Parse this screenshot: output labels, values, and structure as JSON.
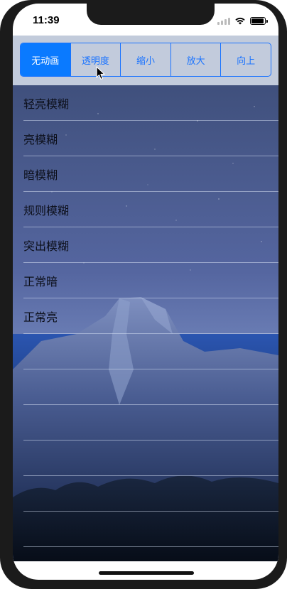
{
  "status_bar": {
    "time": "11:39"
  },
  "segment_control": {
    "selected_index": 0,
    "items": [
      "无动画",
      "透明度",
      "缩小",
      "放大",
      "向上"
    ]
  },
  "list": {
    "rows": [
      "轻亮模糊",
      "亮模糊",
      "暗模糊",
      "规则模糊",
      "突出模糊",
      "正常暗",
      "正常亮",
      "",
      "",
      "",
      "",
      "",
      ""
    ]
  },
  "colors": {
    "accent": "#0a7aff",
    "segment_bar_bg": "#c8d0e0",
    "sky_top": "#3a4a73",
    "sky_mid": "#5566a0",
    "mountain": "#6a7fb0",
    "forest": "#0d1726"
  }
}
